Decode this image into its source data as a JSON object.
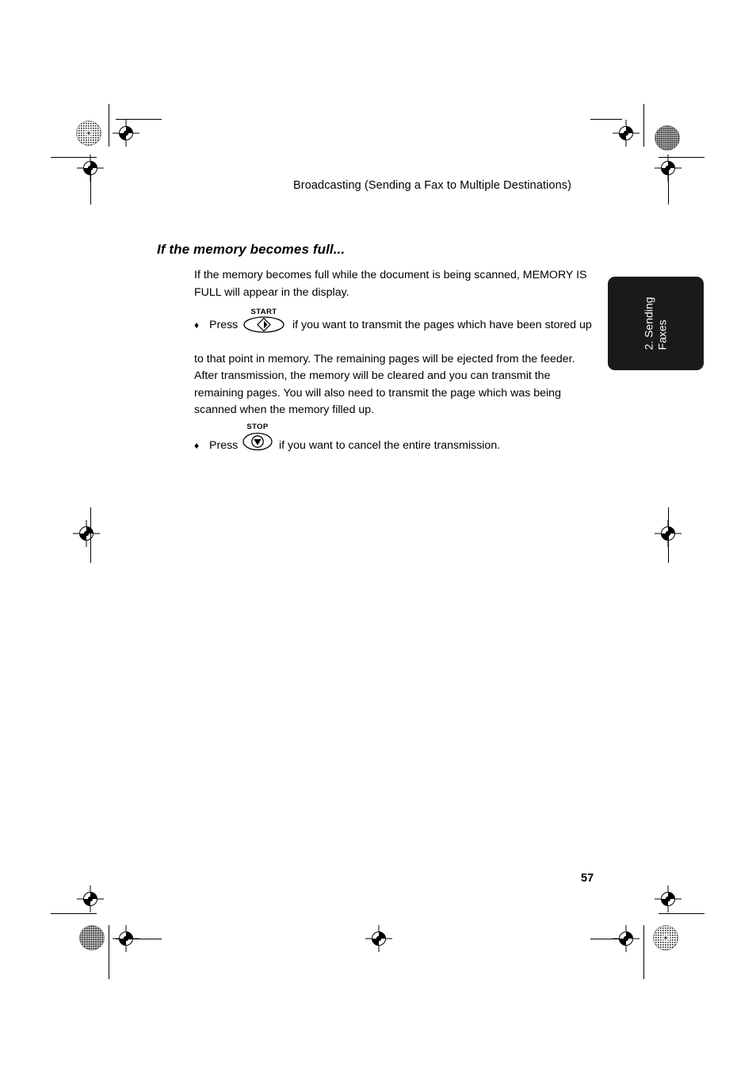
{
  "document": {
    "running_head": "Broadcasting (Sending a Fax to Multiple Destinations)",
    "section_title": "If the memory becomes full...",
    "page_number": "57"
  },
  "body": {
    "intro_paragraph": "If the memory becomes full while the document is being scanned, MEMORY IS FULL will appear in the display.",
    "bullets": [
      {
        "marker": "♦",
        "press_label": "Press",
        "key_label": "START",
        "key_icon": "start-key-icon",
        "text_after_key": "if you want to transmit the pages which have been stored up",
        "continuation": "to that point in memory. The remaining pages will be ejected from the feeder. After transmission, the memory will be cleared and you can transmit the remaining pages. You will also need to transmit the page which was being scanned when the memory filled up."
      },
      {
        "marker": "♦",
        "press_label": "Press",
        "key_label": "STOP",
        "key_icon": "stop-key-icon",
        "text_after_key": "if you want to cancel the entire transmission.",
        "continuation": ""
      }
    ]
  },
  "side_tab": {
    "chapter_number": "2. Sending",
    "chapter_name": "Faxes",
    "background_color": "#1a1a1a",
    "text_color": "#ffffff"
  },
  "print_marks": {
    "registration_icon": "registration-target-icon",
    "halftone_icon": "halftone-dot-icon",
    "trim_line_icon": "trim-line"
  }
}
